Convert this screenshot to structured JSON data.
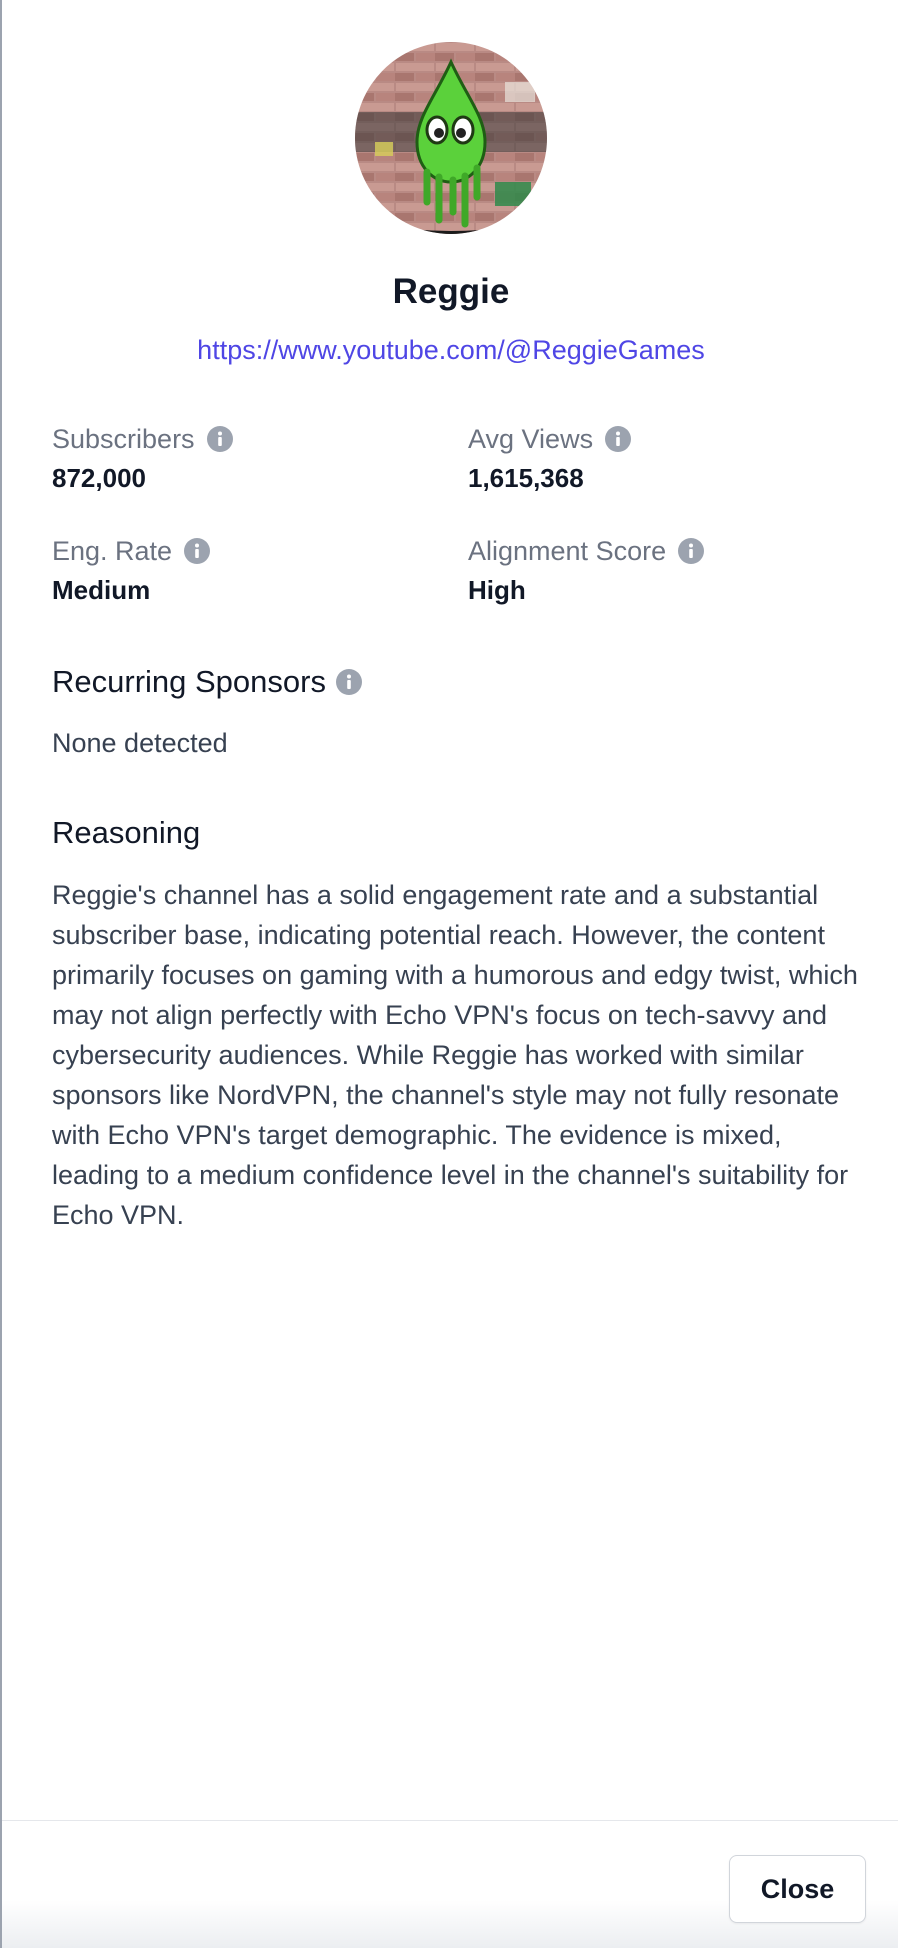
{
  "channel": {
    "name": "Reggie",
    "url": "https://www.youtube.com/@ReggieGames",
    "avatar_icon": "green-droplet-graffiti-avatar"
  },
  "stats": [
    {
      "label": "Subscribers",
      "value": "872,000"
    },
    {
      "label": "Avg Views",
      "value": "1,615,368"
    },
    {
      "label": "Eng. Rate",
      "value": "Medium"
    },
    {
      "label": "Alignment Score",
      "value": "High"
    }
  ],
  "sponsors": {
    "title": "Recurring Sponsors",
    "value": "None detected"
  },
  "reasoning": {
    "title": "Reasoning",
    "text": "Reggie's channel has a solid engagement rate and a substantial subscriber base, indicating potential reach. However, the content primarily focuses on gaming with a humorous and edgy twist, which may not align perfectly with Echo VPN's focus on tech-savvy and cybersecurity audiences. While Reggie has worked with similar sponsors like NordVPN, the channel's style may not fully resonate with Echo VPN's target demographic. The evidence is mixed, leading to a medium confidence level in the channel's suitability for Echo VPN."
  },
  "footer": {
    "close_label": "Close"
  },
  "colors": {
    "link": "#4f46e5",
    "muted": "#6b7280",
    "text": "#111827",
    "info_icon": "#9ca3af"
  },
  "icons": {
    "info": "info-icon"
  }
}
